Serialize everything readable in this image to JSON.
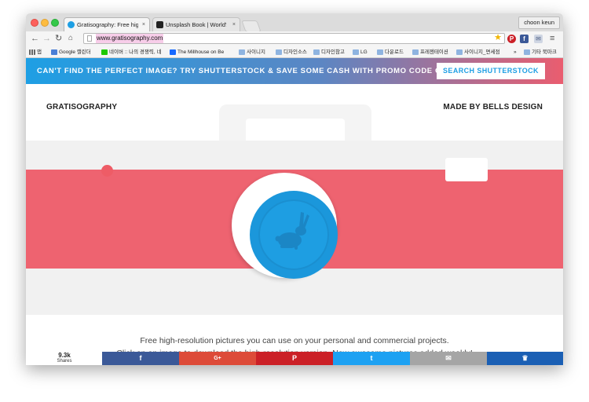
{
  "browser": {
    "tabs": [
      {
        "title": "Gratisography: Free high-r",
        "active": true,
        "favicon_color": "#1e9fe4"
      },
      {
        "title": "Unsplash Book | World's fi",
        "active": false,
        "favicon_color": "#222222"
      }
    ],
    "tab_close_glyph": "×",
    "user": "choon keun",
    "url": "www.gratisography.com",
    "bookmarks": [
      {
        "label": "앱",
        "icon": "apps-icon"
      },
      {
        "label": "Google 캘린더",
        "icon": "calendar-icon"
      },
      {
        "label": "네이버 :: 나의 경쟁력, 네",
        "icon": "naver-icon"
      },
      {
        "label": "The Millhouse on Be",
        "icon": "behance-icon"
      },
      {
        "label": "사이니지",
        "icon": "folder-icon"
      },
      {
        "label": "디자인소스",
        "icon": "folder-icon"
      },
      {
        "label": "디자인참고",
        "icon": "folder-icon"
      },
      {
        "label": "LG",
        "icon": "folder-icon"
      },
      {
        "label": "다운로드",
        "icon": "folder-icon"
      },
      {
        "label": "프레젠테이션",
        "icon": "folder-icon"
      },
      {
        "label": "사이니지_면세점",
        "icon": "folder-icon"
      },
      {
        "label": "»",
        "icon": "overflow-icon"
      },
      {
        "label": "기타 북마크",
        "icon": "folder-icon"
      }
    ]
  },
  "promo": {
    "text": "CAN'T FIND THE PERFECT IMAGE? TRY SHUTTERSTOCK & SAVE SOME CASH WITH PROMO CODE GRATIS",
    "button": "SEARCH SHUTTERSTOCK"
  },
  "header": {
    "title": "GRATISOGRAPHY",
    "made_by": "MADE BY BELLS DESIGN"
  },
  "tagline": [
    "Free high-resolution pictures you can use on your personal and commercial projects.",
    "Click on an image to download the high-resolution version. New awesome pictures added weekly!"
  ],
  "share": {
    "count": "9.3k",
    "label": "Shares",
    "buttons": [
      {
        "icon": "facebook-icon",
        "glyph": "f",
        "color": "#3b5998"
      },
      {
        "icon": "google-plus-icon",
        "glyph": "G+",
        "color": "#dd4b39"
      },
      {
        "icon": "pinterest-icon",
        "glyph": "P",
        "color": "#cb2027"
      },
      {
        "icon": "twitter-icon",
        "glyph": "t",
        "color": "#1da1f2"
      },
      {
        "icon": "email-icon",
        "glyph": "✉",
        "color": "#a5a5a5"
      },
      {
        "icon": "crown-icon",
        "glyph": "♛",
        "color": "#1a5fb4"
      }
    ]
  },
  "colors": {
    "promo_gradient": [
      "#1e9fe4",
      "#5c86c3",
      "#ea5d6f"
    ],
    "camera_stripe": "#ee6370",
    "lens": "#1e9ee2"
  }
}
